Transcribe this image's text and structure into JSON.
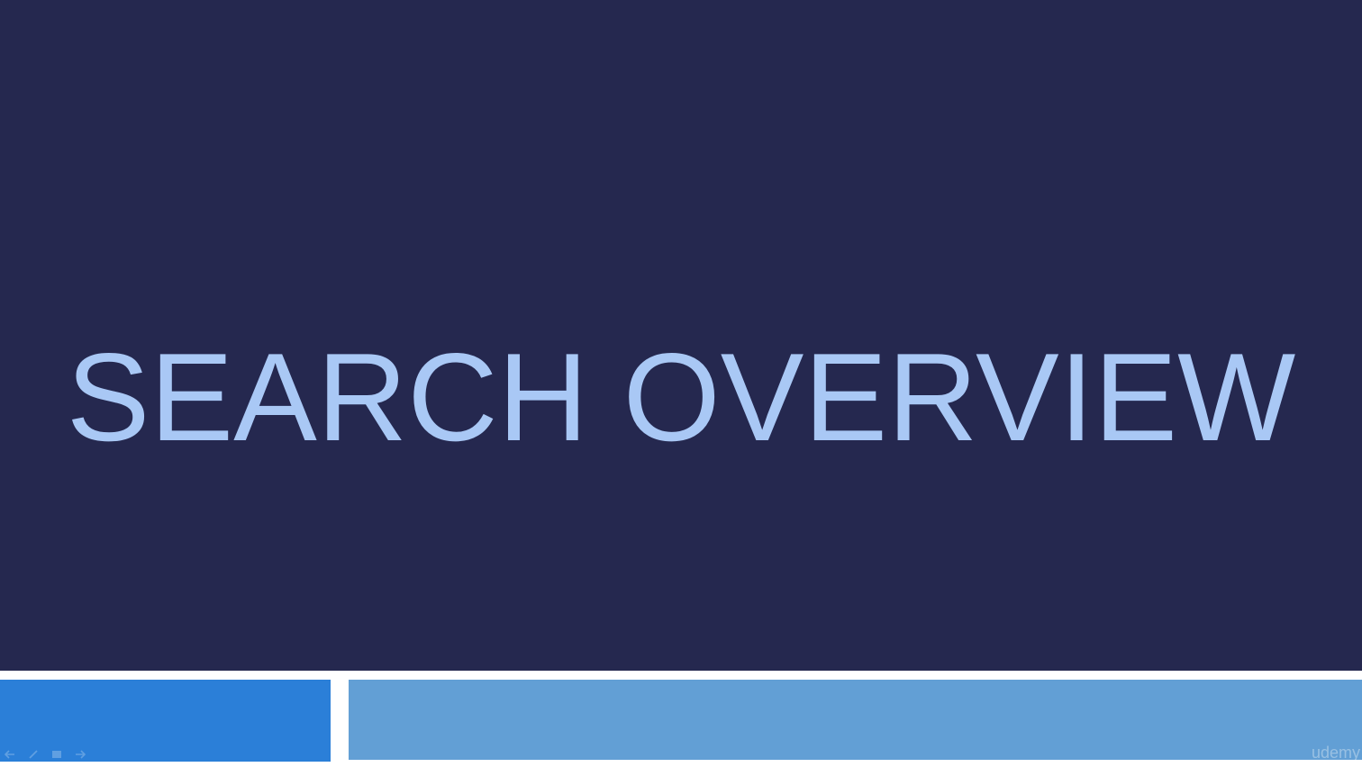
{
  "slide": {
    "title": "SEARCH OVERVIEW",
    "watermark": "udemy"
  },
  "colors": {
    "background": "#25284f",
    "title_text": "#a9c8f5",
    "footer_left": "#2b7fd8",
    "footer_right": "#629fd5",
    "divider": "#ffffff"
  },
  "player_controls": [
    {
      "icon": "previous-slide-icon"
    },
    {
      "icon": "pen-icon"
    },
    {
      "icon": "slides-overview-icon"
    },
    {
      "icon": "next-slide-icon"
    }
  ]
}
